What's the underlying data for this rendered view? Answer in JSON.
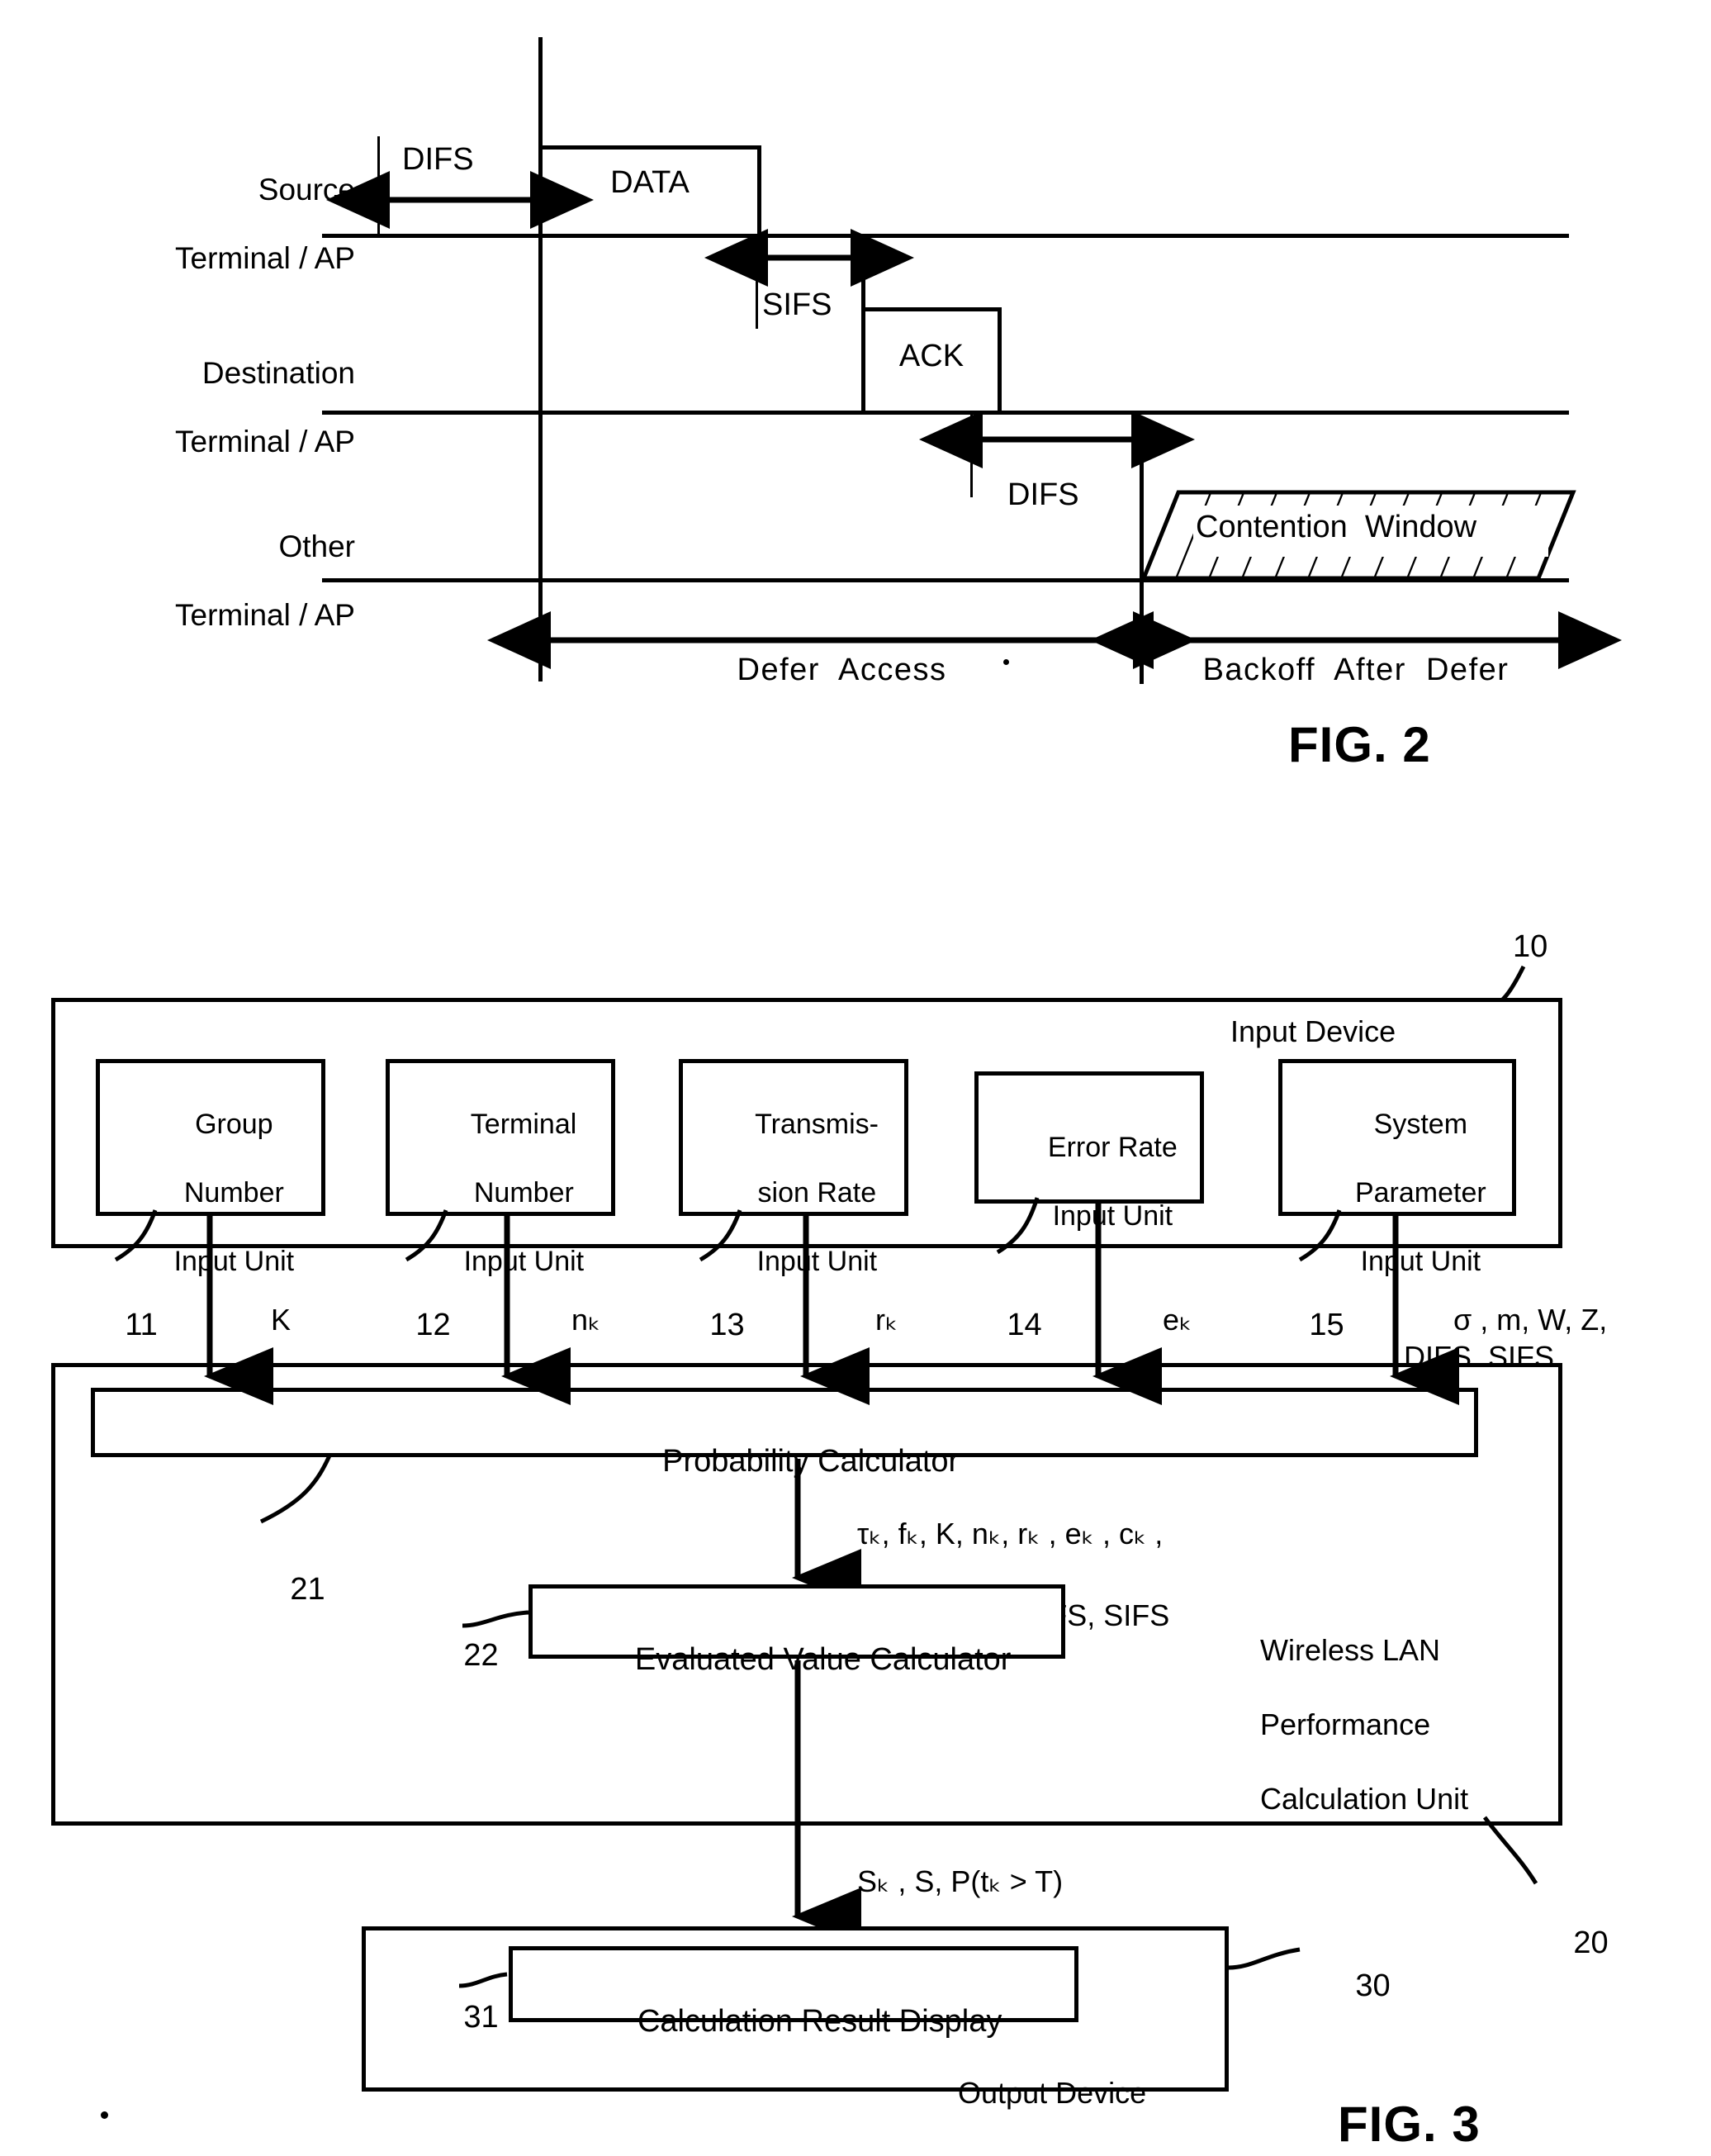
{
  "figures": [
    {
      "id": "fig2",
      "caption": "FIG. 2",
      "rows": [
        {
          "line1": "Source",
          "line2": "Terminal / AP"
        },
        {
          "line1": "Destination",
          "line2": "Terminal / AP"
        },
        {
          "line1": "Other",
          "line2": "Terminal / AP"
        }
      ],
      "frames": [
        {
          "name": "data-frame",
          "label": "DATA"
        },
        {
          "name": "ack-frame",
          "label": "ACK"
        }
      ],
      "intervals": [
        {
          "name": "difs-first",
          "label": "DIFS"
        },
        {
          "name": "sifs",
          "label": "SIFS"
        },
        {
          "name": "difs-second",
          "label": "DIFS"
        }
      ],
      "contention_window_label": "Contention  Window",
      "defer_access_label": "Defer  Access",
      "backoff_label": "Backoff  After  Defer"
    },
    {
      "id": "fig3",
      "caption": "FIG. 3",
      "input_device": {
        "title": "Input Device",
        "ref": "10",
        "units": [
          {
            "ref": "11",
            "symbol": "K",
            "lines": [
              "Group",
              "Number",
              "Input Unit"
            ]
          },
          {
            "ref": "12",
            "symbol": "nₖ",
            "lines": [
              "Terminal",
              "Number",
              "Input Unit"
            ]
          },
          {
            "ref": "13",
            "symbol": "rₖ",
            "lines": [
              "Transmis-",
              "sion Rate",
              "Input Unit"
            ]
          },
          {
            "ref": "14",
            "symbol": "eₖ",
            "lines": [
              "Error Rate",
              "Input Unit"
            ]
          },
          {
            "ref": "15",
            "symbol": "σ , m, W, Z,\nDIFS, SIFS",
            "lines": [
              "System",
              "Parameter",
              "Input Unit"
            ]
          }
        ]
      },
      "calculation_unit": {
        "ref": "20",
        "title_lines": [
          "Wireless LAN",
          "Performance",
          "Calculation Unit"
        ],
        "probability_calculator": {
          "ref": "21",
          "label": "Probability Calculator"
        },
        "evaluated_value_calculator": {
          "ref": "22",
          "label": "Evaluated Value Calculator"
        },
        "mid_signal_line1": "τₖ, fₖ, K, nₖ, rₖ , eₖ , cₖ ,",
        "mid_signal_line2": "σ , m, W, Z, DIFS, SIFS",
        "out_signal": "Sₖ , S, P(tₖ > T)"
      },
      "output_device": {
        "ref": "30",
        "title": "Output Device",
        "display": {
          "ref": "31",
          "label": "Calculation Result Display"
        }
      }
    }
  ],
  "colors": {
    "ink": "#000000",
    "paper": "#ffffff"
  }
}
